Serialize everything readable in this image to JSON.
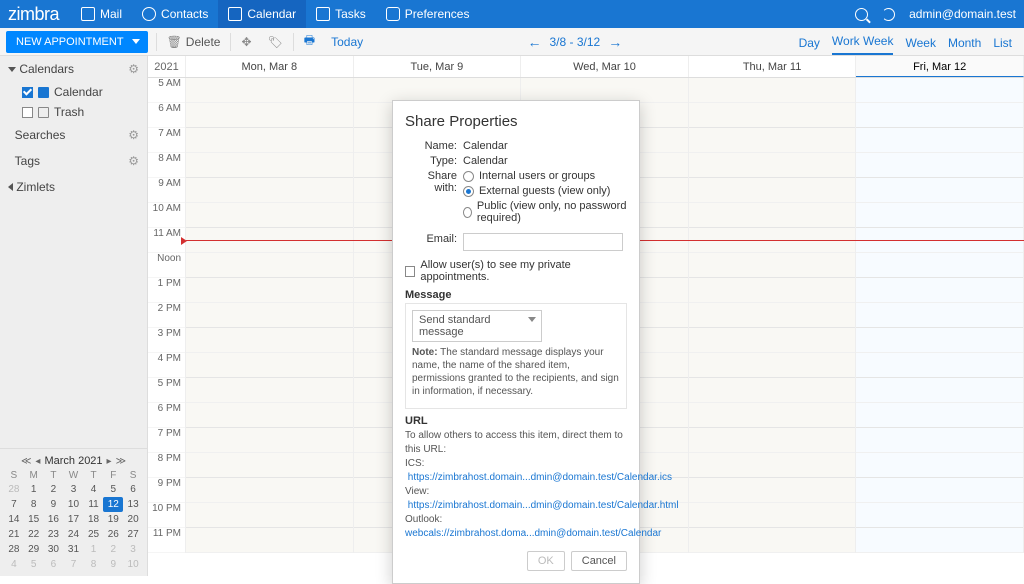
{
  "brand": "zimbra",
  "topnav": {
    "mail": "Mail",
    "contacts": "Contacts",
    "calendar": "Calendar",
    "tasks": "Tasks",
    "preferences": "Preferences"
  },
  "user": "admin@domain.test",
  "toolbar": {
    "new_label": "NEW APPOINTMENT",
    "delete": "Delete",
    "today": "Today",
    "range": "3/8 - 3/12",
    "views": {
      "day": "Day",
      "work_week": "Work Week",
      "week": "Week",
      "month": "Month",
      "list": "List"
    }
  },
  "sidebar": {
    "calendars": "Calendars",
    "calendar_item": "Calendar",
    "trash_item": "Trash",
    "searches": "Searches",
    "tags": "Tags",
    "zimlets": "Zimlets"
  },
  "minical": {
    "title": "March 2021",
    "dow": [
      "S",
      "M",
      "T",
      "W",
      "T",
      "F",
      "S"
    ],
    "weeks": [
      [
        {
          "d": "28",
          "dim": true
        },
        {
          "d": "1"
        },
        {
          "d": "2"
        },
        {
          "d": "3"
        },
        {
          "d": "4"
        },
        {
          "d": "5"
        },
        {
          "d": "6"
        }
      ],
      [
        {
          "d": "7"
        },
        {
          "d": "8"
        },
        {
          "d": "9"
        },
        {
          "d": "10"
        },
        {
          "d": "11"
        },
        {
          "d": "12",
          "today": true
        },
        {
          "d": "13"
        }
      ],
      [
        {
          "d": "14"
        },
        {
          "d": "15"
        },
        {
          "d": "16"
        },
        {
          "d": "17"
        },
        {
          "d": "18"
        },
        {
          "d": "19"
        },
        {
          "d": "20"
        }
      ],
      [
        {
          "d": "21"
        },
        {
          "d": "22"
        },
        {
          "d": "23"
        },
        {
          "d": "24"
        },
        {
          "d": "25"
        },
        {
          "d": "26"
        },
        {
          "d": "27"
        }
      ],
      [
        {
          "d": "28"
        },
        {
          "d": "29"
        },
        {
          "d": "30"
        },
        {
          "d": "31"
        },
        {
          "d": "1",
          "dim": true
        },
        {
          "d": "2",
          "dim": true
        },
        {
          "d": "3",
          "dim": true
        }
      ],
      [
        {
          "d": "4",
          "dim": true
        },
        {
          "d": "5",
          "dim": true
        },
        {
          "d": "6",
          "dim": true
        },
        {
          "d": "7",
          "dim": true
        },
        {
          "d": "8",
          "dim": true
        },
        {
          "d": "9",
          "dim": true
        },
        {
          "d": "10",
          "dim": true
        }
      ]
    ]
  },
  "calendar": {
    "year": "2021",
    "days": [
      "Mon, Mar 8",
      "Tue, Mar 9",
      "Wed, Mar 10",
      "Thu, Mar 11",
      "Fri, Mar 12"
    ],
    "today_index": 4,
    "hours": [
      "5 AM",
      "6 AM",
      "7 AM",
      "8 AM",
      "9 AM",
      "10 AM",
      "11 AM",
      "Noon",
      "1 PM",
      "2 PM",
      "3 PM",
      "4 PM",
      "5 PM",
      "6 PM",
      "7 PM",
      "8 PM",
      "9 PM",
      "10 PM",
      "11 PM"
    ]
  },
  "modal": {
    "title": "Share Properties",
    "name_lbl": "Name:",
    "name_val": "Calendar",
    "type_lbl": "Type:",
    "type_val": "Calendar",
    "share_lbl": "Share with:",
    "opt_internal": "Internal users or groups",
    "opt_external": "External guests (view only)",
    "opt_public": "Public (view only, no password required)",
    "email_lbl": "Email:",
    "allow_private": "Allow user(s) to see my private appointments.",
    "message_lbl": "Message",
    "message_select": "Send standard message",
    "note_label": "Note:",
    "note_text": " The standard message displays your name, the name of the shared item, permissions granted to the recipients, and sign in information, if necessary.",
    "url_lbl": "URL",
    "url_intro": "To allow others to access this item, direct them to this URL:",
    "url_ics_lbl": "ICS:",
    "url_ics": "https://zimbrahost.domain...dmin@domain.test/Calendar.ics",
    "url_view_lbl": "View:",
    "url_view": "https://zimbrahost.domain...dmin@domain.test/Calendar.html",
    "url_outlook_lbl": "Outlook:",
    "url_outlook": "webcals://zimbrahost.doma...dmin@domain.test/Calendar",
    "ok": "OK",
    "cancel": "Cancel"
  }
}
